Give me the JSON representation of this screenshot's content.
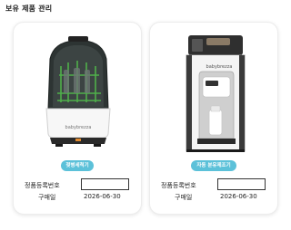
{
  "page": {
    "title": "보유 제품 관리"
  },
  "colors": {
    "accent": "#5cc1d9",
    "card_border": "#ececec"
  },
  "products": [
    {
      "image_text": "babybrezza",
      "chip_label": "젖병세척기",
      "serial_label": "정품등록번호",
      "serial_value": "",
      "purchase_label": "구매일",
      "purchase_date": "2026-06-30"
    },
    {
      "image_text": "babybrezza",
      "chip_label": "자동 분유제조기",
      "serial_label": "정품등록번호",
      "serial_value": "",
      "purchase_label": "구매일",
      "purchase_date": "2026-06-30"
    }
  ]
}
